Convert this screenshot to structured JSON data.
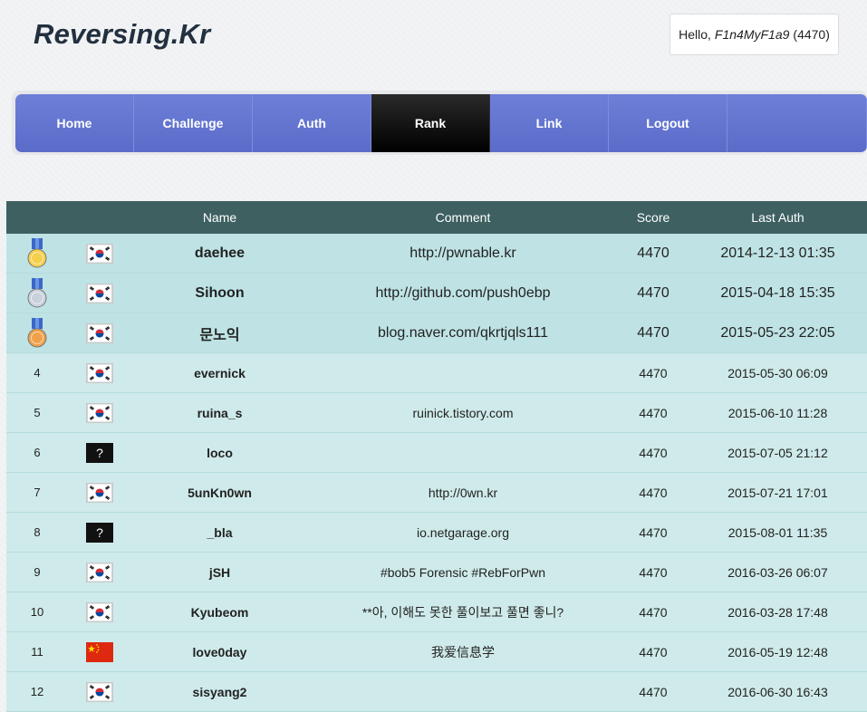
{
  "site": {
    "logo": "Reversing.Kr"
  },
  "greeting": {
    "prefix": "Hello,",
    "user": "F1n4MyF1a9",
    "score": "(4470)"
  },
  "nav": {
    "items": [
      "Home",
      "Challenge",
      "Auth",
      "Rank",
      "Link",
      "Logout"
    ],
    "active": "Rank"
  },
  "table": {
    "headers": {
      "rank": "",
      "flag": "",
      "name": "Name",
      "comment": "Comment",
      "score": "Score",
      "last_auth": "Last Auth"
    },
    "rows": [
      {
        "rank": "",
        "medal": "gold-medal-icon",
        "flag": "kr",
        "name": "daehee",
        "comment": "http://pwnable.kr",
        "score": "4470",
        "last_auth": "2014-12-13 01:35"
      },
      {
        "rank": "",
        "medal": "silver-medal-icon",
        "flag": "kr",
        "name": "Sihoon",
        "comment": "http://github.com/push0ebp",
        "score": "4470",
        "last_auth": "2015-04-18 15:35"
      },
      {
        "rank": "",
        "medal": "bronze-medal-icon",
        "flag": "kr",
        "name": "문노익",
        "comment": "blog.naver.com/qkrtjqls111",
        "score": "4470",
        "last_auth": "2015-05-23 22:05"
      },
      {
        "rank": "4",
        "flag": "kr",
        "name": "evernick",
        "comment": "",
        "score": "4470",
        "last_auth": "2015-05-30 06:09"
      },
      {
        "rank": "5",
        "flag": "kr",
        "name": "ruina_s",
        "comment": "ruinick.tistory.com",
        "score": "4470",
        "last_auth": "2015-06-10 11:28"
      },
      {
        "rank": "6",
        "flag": "unknown",
        "name": "loco",
        "comment": "",
        "score": "4470",
        "last_auth": "2015-07-05 21:12"
      },
      {
        "rank": "7",
        "flag": "kr",
        "name": "5unKn0wn",
        "comment": "http://0wn.kr",
        "score": "4470",
        "last_auth": "2015-07-21 17:01"
      },
      {
        "rank": "8",
        "flag": "unknown",
        "name": "_bla",
        "comment": "io.netgarage.org",
        "score": "4470",
        "last_auth": "2015-08-01 11:35"
      },
      {
        "rank": "9",
        "flag": "kr",
        "name": "jSH",
        "comment": "#bob5 Forensic #RebForPwn",
        "score": "4470",
        "last_auth": "2016-03-26 06:07"
      },
      {
        "rank": "10",
        "flag": "kr",
        "name": "Kyubeom",
        "comment": "**아, 이해도 못한 풀이보고 풀면 좋니?",
        "score": "4470",
        "last_auth": "2016-03-28 17:48"
      },
      {
        "rank": "11",
        "flag": "cn",
        "name": "love0day",
        "comment": "我爱信息学",
        "score": "4470",
        "last_auth": "2016-05-19 12:48"
      },
      {
        "rank": "12",
        "flag": "kr",
        "name": "sisyang2",
        "comment": "",
        "score": "4470",
        "last_auth": "2016-06-30 16:43"
      }
    ]
  },
  "colors": {
    "nav": "#6577d2",
    "nav_active": "#000000",
    "table_header": "#3e6061",
    "row": "#cfeaea",
    "row_top": "#bfe3e4"
  },
  "unknown_flag_glyph": "?"
}
